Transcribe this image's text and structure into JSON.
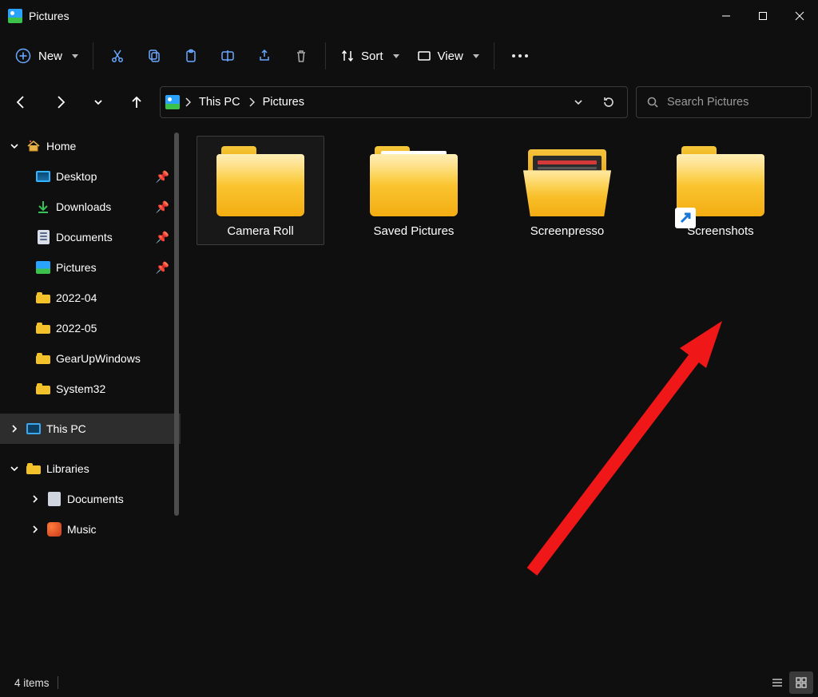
{
  "window": {
    "title": "Pictures"
  },
  "toolbar": {
    "new_label": "New",
    "sort_label": "Sort",
    "view_label": "View"
  },
  "breadcrumb": {
    "root": "This PC",
    "current": "Pictures"
  },
  "search": {
    "placeholder": "Search Pictures"
  },
  "sidebar": {
    "home": "Home",
    "quick": [
      {
        "label": "Desktop"
      },
      {
        "label": "Downloads"
      },
      {
        "label": "Documents"
      },
      {
        "label": "Pictures"
      },
      {
        "label": "2022-04"
      },
      {
        "label": "2022-05"
      },
      {
        "label": "GearUpWindows"
      },
      {
        "label": "System32"
      }
    ],
    "this_pc": "This PC",
    "libraries": "Libraries",
    "lib_children": [
      {
        "label": "Documents"
      },
      {
        "label": "Music"
      }
    ]
  },
  "folders": [
    {
      "name": "Camera Roll",
      "selected": true,
      "variant": "closed"
    },
    {
      "name": "Saved Pictures",
      "selected": false,
      "variant": "sheet"
    },
    {
      "name": "Screenpresso",
      "selected": false,
      "variant": "open-thumb"
    },
    {
      "name": "Screenshots",
      "selected": false,
      "variant": "shortcut"
    }
  ],
  "status": {
    "count_label": "4 items"
  }
}
